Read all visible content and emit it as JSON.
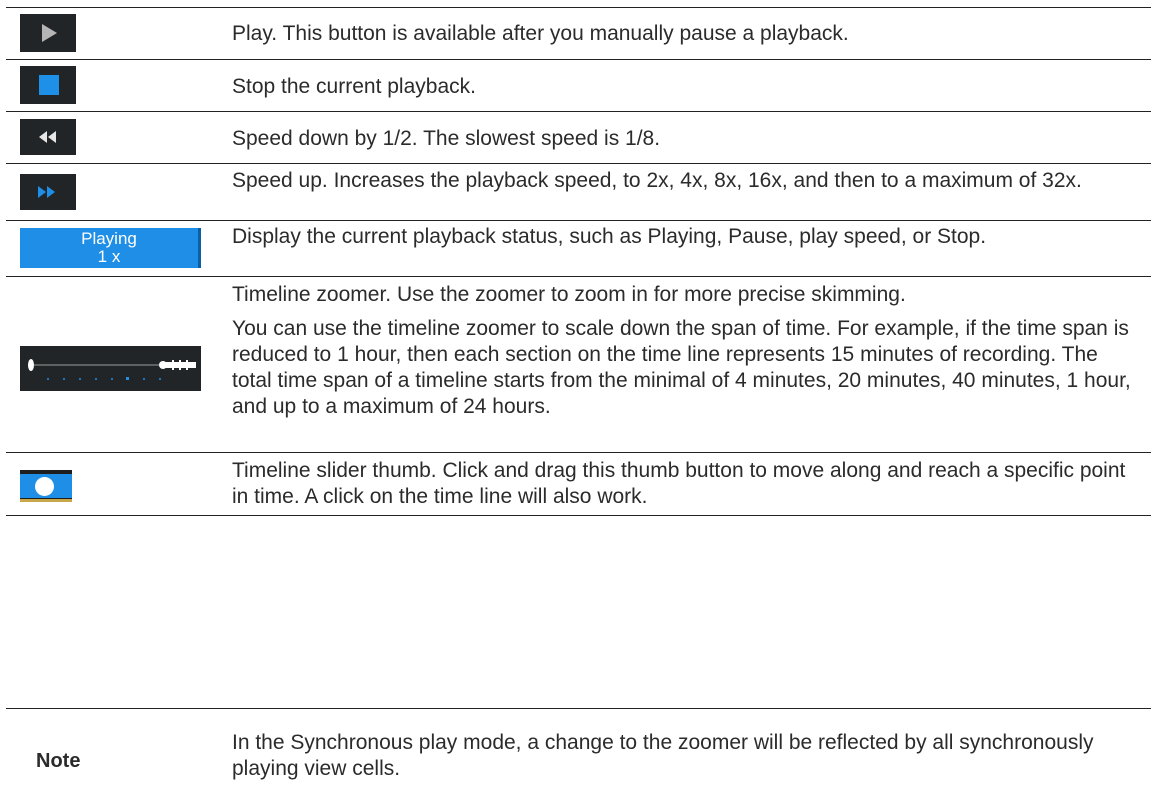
{
  "rows": [
    {
      "icon": "play-icon",
      "text": "Play. This button is available after you manually pause a playback."
    },
    {
      "icon": "stop-icon",
      "text": "Stop the current playback."
    },
    {
      "icon": "rewind-icon",
      "text": "Speed down by 1/2. The slowest speed is 1/8."
    },
    {
      "icon": "fast-forward-icon",
      "text": "Speed up. Increases the playback speed, to 2x, 4x, 8x, 16x, and then to a maximum of 32x."
    },
    {
      "icon": "playback-status-indicator",
      "status_label": "Playing",
      "status_speed": "1 x",
      "text": "Display the current playback status, such as Playing, Pause, play speed, or Stop."
    },
    {
      "icon": "timeline-zoomer-icon",
      "text": "Timeline zoomer. Use the zoomer to zoom in for more precise skimming.",
      "text2": "You can use the timeline zoomer to scale down the span of time. For example, if the time span is reduced to 1 hour, then each section on the time line represents 15 minutes of recording. The total time span of a timeline starts from the minimal of 4 minutes, 20 minutes, 40 minutes, 1 hour, and up to a maximum of 24 hours."
    },
    {
      "icon": "timeline-slider-thumb-icon",
      "text": "Timeline slider thumb. Click and drag this thumb button to move along and reach a specific point in time. A click on the time line will also work."
    }
  ],
  "note": {
    "label": "Note",
    "text": "In the Synchronous play mode, a change to the zoomer will be reflected by all synchronously playing view cells."
  },
  "colors": {
    "accent_blue": "#1e8ee6",
    "icon_bg": "#222528",
    "rule": "#222222"
  }
}
